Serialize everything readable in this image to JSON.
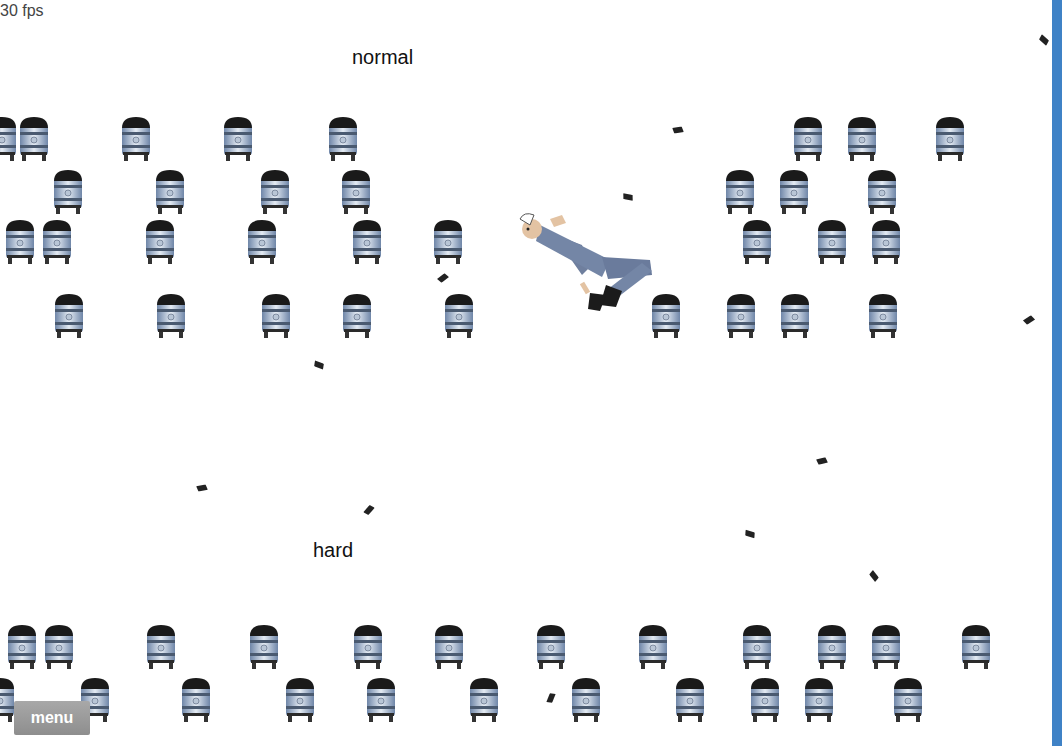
{
  "hud": {
    "fps": "30 fps"
  },
  "labels": [
    {
      "text": "normal"
    },
    {
      "text": "hard"
    }
  ],
  "buttons": [
    {
      "label": "menu"
    }
  ]
}
